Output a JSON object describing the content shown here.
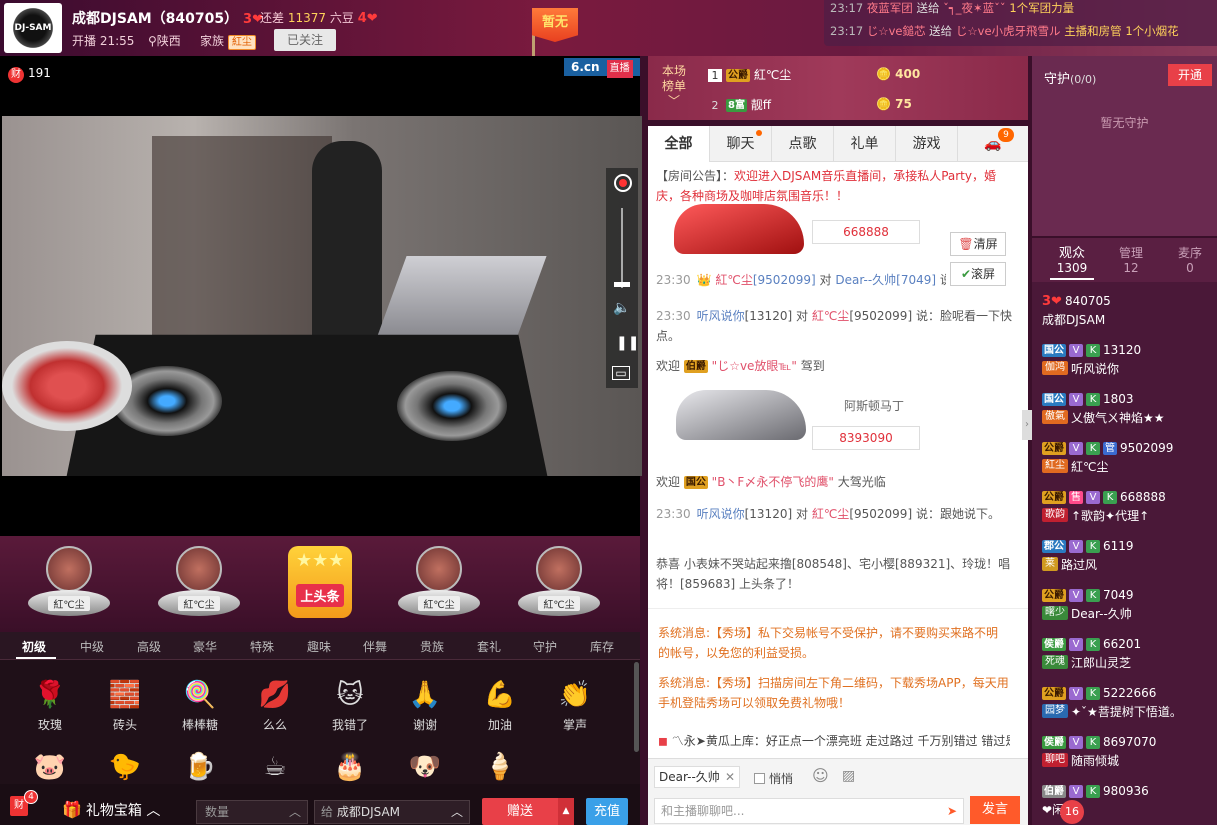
{
  "header": {
    "anchor_name": "成都DJSAM（840705）",
    "anchor_level": "3",
    "gap_prefix": "还差",
    "gap_value": "11377",
    "gap_suffix": "六豆",
    "next_level": "4",
    "live_time": "开播 21:55",
    "location": "陕西",
    "family_label": "家族",
    "family_tag": "紅尘",
    "follow_label": "已关注",
    "flag_label": "暂无",
    "logo_text": "DJ-SAM"
  },
  "top_messages": [
    {
      "time": "23:17",
      "from": "夜蓝军团",
      "verb": "送给",
      "to": "ˇ┑_夜✶蓝ˇˇ",
      "gift": "1个军团力量"
    },
    {
      "time": "23:17",
      "from": "じ☆ve鎚芯",
      "verb": "送给",
      "to": "じ☆ve小虎牙飛雪ル",
      "gift": "主播和房管 1个小烟花"
    }
  ],
  "video": {
    "wealth_icon": "财",
    "wealth_count": "191",
    "site_logo": "6.cn",
    "site_live": "直播"
  },
  "headline": {
    "podium_names": [
      "紅℃尘",
      "紅℃尘",
      "紅℃尘",
      "紅℃尘"
    ],
    "center_label": "上头条"
  },
  "gift_tabs": [
    "初级",
    "中级",
    "高级",
    "豪华",
    "特殊",
    "趣味",
    "伴舞",
    "贵族",
    "套礼",
    "守护",
    "库存"
  ],
  "gifts": [
    {
      "name": "玫瑰",
      "icon": "🌹"
    },
    {
      "name": "砖头",
      "icon": "🧱"
    },
    {
      "name": "棒棒糖",
      "icon": "🍭"
    },
    {
      "name": "么么",
      "icon": "💋"
    },
    {
      "name": "我错了",
      "icon": "🐱"
    },
    {
      "name": "谢谢",
      "icon": "🙏"
    },
    {
      "name": "加油",
      "icon": "💪"
    },
    {
      "name": "掌声",
      "icon": "👏"
    },
    {
      "name": "",
      "icon": "🐷"
    },
    {
      "name": "",
      "icon": "🐤"
    },
    {
      "name": "",
      "icon": "🍺"
    },
    {
      "name": "",
      "icon": "☕"
    },
    {
      "name": "",
      "icon": "🎂"
    },
    {
      "name": "",
      "icon": "🐶"
    },
    {
      "name": "",
      "icon": "🍦"
    }
  ],
  "bottom_bar": {
    "wealth_icon": "财",
    "wealth_badge": "4",
    "giftbox_label": "礼物宝箱",
    "qty_placeholder": "数量",
    "to_label": "给",
    "to_value": "成都DJSAM",
    "send_label": "赠送",
    "recharge_label": "充值"
  },
  "rank": {
    "label_line1": "本场",
    "label_line2": "榜单",
    "rows": [
      {
        "no": "1",
        "noble": "公爵",
        "name": "紅℃尘",
        "value": "400"
      },
      {
        "no": "2",
        "noble": "8富",
        "name": "靓ff",
        "value": "75"
      }
    ]
  },
  "chat_tabs": [
    "全部",
    "聊天",
    "点歌",
    "礼单",
    "游戏"
  ],
  "car_badge": "9",
  "chat": {
    "notice_prefix": "【房间公告】：",
    "notice_text": "欢迎进入DJSAM音乐直播间，承接私人Party，婚庆，各种商场及咖啡店氛围音乐！！",
    "car1_value": "668888",
    "line1": {
      "time": "23:30",
      "from": "紅℃尘",
      "from_id": "[9502099]",
      "mid": "对",
      "to": "Dear--久帅",
      "to_id": "[7049]",
      "tail": "说："
    },
    "line2": {
      "time": "23:30",
      "from": "听风说你",
      "from_id": "[13120]",
      "mid": "对",
      "to": "紅℃尘",
      "to_id": "[9502099]",
      "tail": "说：脸呢看一下快点。"
    },
    "welcome1": {
      "prefix": "欢迎",
      "noble": "伯爵",
      "name": "\"じ☆ve放眼℡\"",
      "suffix": "驾到"
    },
    "car2_name": "阿斯顿马丁",
    "car2_value": "8393090",
    "welcome2": {
      "prefix": "欢迎",
      "noble": "国公",
      "name": "\"B丶F〆永不停飞的鹰\"",
      "suffix": "大驾光临"
    },
    "line3": {
      "time": "23:30",
      "from": "听风说你",
      "from_id": "[13120]",
      "mid": "对",
      "to": "紅℃尘",
      "to_id": "[9502099]",
      "tail": "说：跟她说下。"
    },
    "congrats": "恭喜 小表妹不哭站起来撸[808548]、宅小樱[889321]、玲珑！唱将！[859683] 上头条了！",
    "clear_label": "清屏",
    "scroll_label": "滚屏"
  },
  "system": {
    "msg1": "系统消息:【秀场】私下交易帐号不受保护，请不要购买来路不明的帐号，以免您的利益受损。",
    "msg2": "系统消息:【秀场】扫描房间左下角二维码，下载秀场APP，每天用手机登陆秀场可以领取免费礼物哦！",
    "msg3": "〽永➤黄瓜上库：好正点一个漂亮班 走过路过 千万别错过 错过是"
  },
  "chat_input": {
    "to_chip": "Dear--久帅",
    "whisper_label": "悄悄",
    "placeholder": "和主播聊聊吧...",
    "send_label": "发言"
  },
  "guard": {
    "title": "守护",
    "count": "(0/0)",
    "open_label": "开通",
    "empty_text": "暂无守护"
  },
  "audience_tabs": [
    {
      "label": "观众",
      "count": "1309"
    },
    {
      "label": "管理",
      "count": "12"
    },
    {
      "label": "麦序",
      "count": "0"
    }
  ],
  "audience": [
    {
      "id": "840705",
      "name": "成都DJSAM",
      "level": "3",
      "noble": "",
      "fam": ""
    },
    {
      "id": "13120",
      "name": "听风说你",
      "noble": "国公",
      "fam": "伽鸿"
    },
    {
      "id": "1803",
      "name": "乂傲气ㄨ神焰★★",
      "noble": "国公",
      "fam": "傲氣"
    },
    {
      "id": "9502099",
      "name": "紅℃尘",
      "noble": "公爵",
      "fam": "紅尘"
    },
    {
      "id": "668888",
      "name": "↑歌韵✦代理↑",
      "noble": "公爵",
      "fam": "歌韵"
    },
    {
      "id": "6119",
      "name": "路过风",
      "noble": "郡公",
      "fam": "莱"
    },
    {
      "id": "7049",
      "name": "Dear--久帅",
      "noble": "公爵",
      "fam": "曙少"
    },
    {
      "id": "66201",
      "name": "江郎山灵芝",
      "noble": "侯爵",
      "fam": "死魂"
    },
    {
      "id": "5222666",
      "name": "✦ˇ★菩提树下悟道。",
      "noble": "公爵",
      "fam": "园梦"
    },
    {
      "id": "8697070",
      "name": "随雨倾城",
      "noble": "侯爵",
      "fam": "聊吧"
    },
    {
      "id": "980936",
      "name": "❤闲❤",
      "noble": "伯爵",
      "fam": ""
    }
  ],
  "audience_badge": "16"
}
